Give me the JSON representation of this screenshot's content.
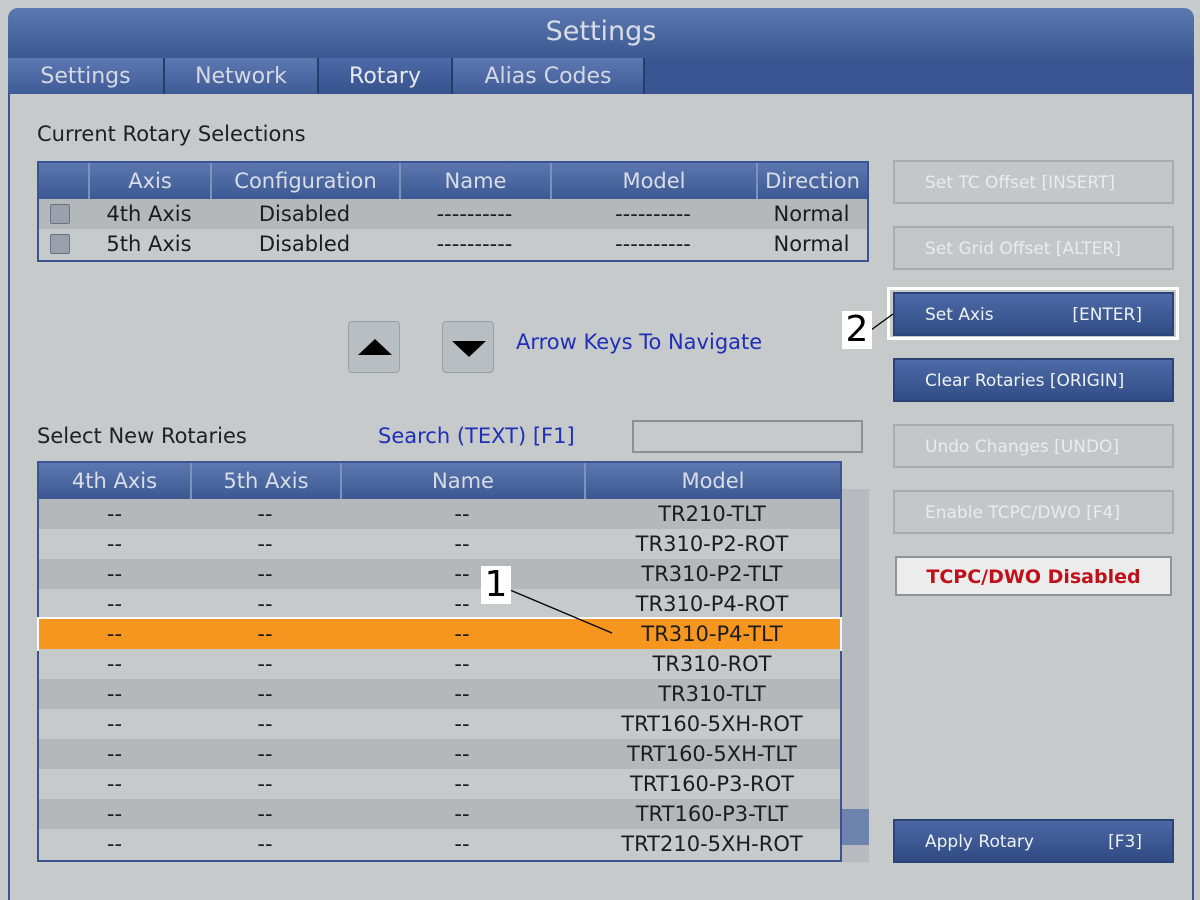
{
  "window": {
    "title": "Settings"
  },
  "tabs": [
    {
      "label": "Settings"
    },
    {
      "label": "Network"
    },
    {
      "label": "Rotary"
    },
    {
      "label": "Alias Codes"
    }
  ],
  "current": {
    "heading": "Current Rotary Selections",
    "columns": [
      "Axis",
      "Configuration",
      "Name",
      "Model",
      "Direction"
    ],
    "rows": [
      {
        "axis": "4th Axis",
        "configuration": "Disabled",
        "name": "----------",
        "model": "----------",
        "direction": "Normal"
      },
      {
        "axis": "5th Axis",
        "configuration": "Disabled",
        "name": "----------",
        "model": "----------",
        "direction": "Normal"
      }
    ]
  },
  "navigation": {
    "hint": "Arrow Keys To Navigate"
  },
  "select": {
    "heading": "Select New Rotaries",
    "search_label": "Search (TEXT) [F1]",
    "search_value": "",
    "columns": [
      "4th Axis",
      "5th Axis",
      "Name",
      "Model"
    ],
    "rows": [
      {
        "a4": "--",
        "a5": "--",
        "name": "--",
        "model": "TR210-TLT"
      },
      {
        "a4": "--",
        "a5": "--",
        "name": "--",
        "model": "TR310-P2-ROT"
      },
      {
        "a4": "--",
        "a5": "--",
        "name": "--",
        "model": "TR310-P2-TLT"
      },
      {
        "a4": "--",
        "a5": "--",
        "name": "--",
        "model": "TR310-P4-ROT"
      },
      {
        "a4": "--",
        "a5": "--",
        "name": "--",
        "model": "TR310-P4-TLT"
      },
      {
        "a4": "--",
        "a5": "--",
        "name": "--",
        "model": "TR310-ROT"
      },
      {
        "a4": "--",
        "a5": "--",
        "name": "--",
        "model": "TR310-TLT"
      },
      {
        "a4": "--",
        "a5": "--",
        "name": "--",
        "model": "TRT160-5XH-ROT"
      },
      {
        "a4": "--",
        "a5": "--",
        "name": "--",
        "model": "TRT160-5XH-TLT"
      },
      {
        "a4": "--",
        "a5": "--",
        "name": "--",
        "model": "TRT160-P3-ROT"
      },
      {
        "a4": "--",
        "a5": "--",
        "name": "--",
        "model": "TRT160-P3-TLT"
      },
      {
        "a4": "--",
        "a5": "--",
        "name": "--",
        "model": "TRT210-5XH-ROT"
      }
    ],
    "selected_index": 4
  },
  "buttons": {
    "set_tc_offset": {
      "label": "Set TC Offset [INSERT]"
    },
    "set_grid_offset": {
      "label": "Set Grid Offset [ALTER]"
    },
    "set_axis": {
      "label": "Set Axis",
      "key": "[ENTER]"
    },
    "clear_rotaries": {
      "label": "Clear Rotaries [ORIGIN]"
    },
    "undo_changes": {
      "label": "Undo Changes [UNDO]"
    },
    "enable_tcpc": {
      "label": "Enable TCPC/DWO [F4]"
    },
    "apply_rotary": {
      "label": "Apply Rotary",
      "key": "[F3]"
    }
  },
  "status": {
    "tcpc": "TCPC/DWO Disabled"
  },
  "callouts": {
    "one": "1",
    "two": "2"
  },
  "colors": {
    "accent_blue": "#3f5b96",
    "selection_orange": "#f6961f",
    "status_red": "#c0101a",
    "panel_gray": "#c6cacb"
  }
}
